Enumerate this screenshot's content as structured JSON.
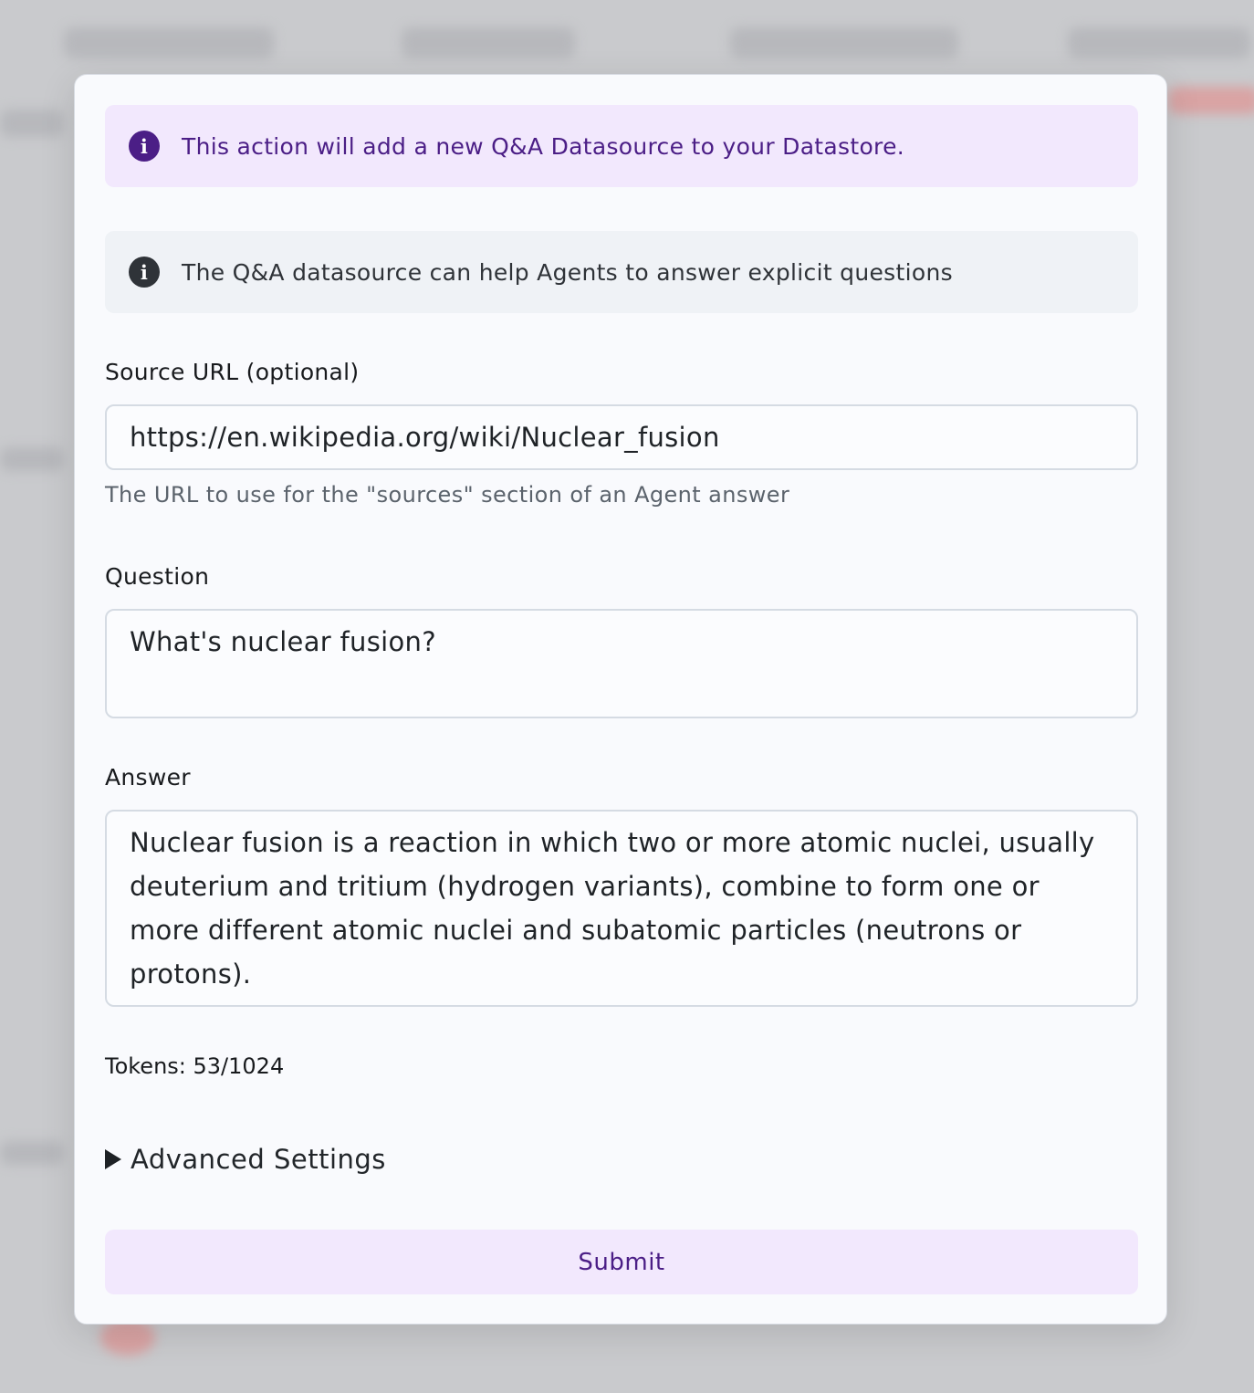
{
  "modal": {
    "alert_primary": {
      "icon": "info-icon",
      "text": "This action will add a new Q&A Datasource to your Datastore."
    },
    "alert_neutral": {
      "icon": "info-icon",
      "text": "The Q&A datasource can help Agents to answer explicit questions"
    },
    "source_url": {
      "label": "Source URL (optional)",
      "value": "https://en.wikipedia.org/wiki/Nuclear_fusion",
      "helper": "The URL to use for the \"sources\" section of an Agent answer"
    },
    "question": {
      "label": "Question",
      "value": "What's nuclear fusion?"
    },
    "answer": {
      "label": "Answer",
      "value": "Nuclear fusion is a reaction in which two or more atomic nuclei, usually deuterium and tritium (hydrogen variants), combine to form one or more different atomic nuclei and subatomic particles (neutrons or protons)."
    },
    "tokens": "Tokens: 53/1024",
    "advanced_settings": "Advanced Settings",
    "submit_label": "Submit"
  },
  "colors": {
    "primary": "#4b1e86",
    "primary_soft": "#f2e8fd",
    "neutral_soft": "#eff2f6"
  }
}
